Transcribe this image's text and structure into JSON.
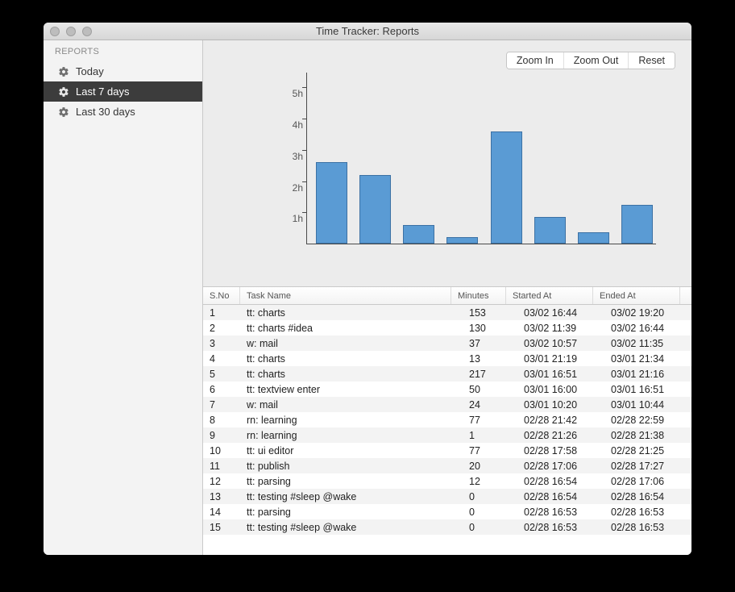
{
  "window": {
    "title": "Time Tracker: Reports"
  },
  "sidebar": {
    "header": "REPORTS",
    "items": [
      {
        "label": "Today",
        "selected": false
      },
      {
        "label": "Last 7 days",
        "selected": true
      },
      {
        "label": "Last 30 days",
        "selected": false
      }
    ]
  },
  "toolbar": {
    "zoom_in": "Zoom In",
    "zoom_out": "Zoom Out",
    "reset": "Reset"
  },
  "chart_data": {
    "type": "bar",
    "title": "",
    "xlabel": "",
    "ylabel": "",
    "ytick_labels": [
      "1h",
      "2h",
      "3h",
      "4h",
      "5h"
    ],
    "ylim": [
      0,
      5.5
    ],
    "categories": [
      "",
      "",
      "",
      "",
      "",
      "",
      "",
      ""
    ],
    "values": [
      2.6,
      2.2,
      0.6,
      0.2,
      3.6,
      0.85,
      0.35,
      1.25
    ],
    "bar_color": "#5a9bd4"
  },
  "table": {
    "columns": [
      "S.No",
      "Task Name",
      "Minutes",
      "Started At",
      "Ended At"
    ],
    "rows": [
      {
        "sno": 1,
        "task": "tt: charts",
        "minutes": 153,
        "start": "03/02 16:44",
        "end": "03/02 19:20"
      },
      {
        "sno": 2,
        "task": "tt: charts #idea",
        "minutes": 130,
        "start": "03/02 11:39",
        "end": "03/02 16:44"
      },
      {
        "sno": 3,
        "task": "w: mail",
        "minutes": 37,
        "start": "03/02 10:57",
        "end": "03/02 11:35"
      },
      {
        "sno": 4,
        "task": "tt: charts",
        "minutes": 13,
        "start": "03/01 21:19",
        "end": "03/01 21:34"
      },
      {
        "sno": 5,
        "task": "tt: charts",
        "minutes": 217,
        "start": "03/01 16:51",
        "end": "03/01 21:16"
      },
      {
        "sno": 6,
        "task": "tt: textview enter",
        "minutes": 50,
        "start": "03/01 16:00",
        "end": "03/01 16:51"
      },
      {
        "sno": 7,
        "task": "w: mail",
        "minutes": 24,
        "start": "03/01 10:20",
        "end": "03/01 10:44"
      },
      {
        "sno": 8,
        "task": "rn: learning",
        "minutes": 77,
        "start": "02/28 21:42",
        "end": "02/28 22:59"
      },
      {
        "sno": 9,
        "task": "rn: learning",
        "minutes": 1,
        "start": "02/28 21:26",
        "end": "02/28 21:38"
      },
      {
        "sno": 10,
        "task": "tt: ui editor",
        "minutes": 77,
        "start": "02/28 17:58",
        "end": "02/28 21:25"
      },
      {
        "sno": 11,
        "task": "tt: publish",
        "minutes": 20,
        "start": "02/28 17:06",
        "end": "02/28 17:27"
      },
      {
        "sno": 12,
        "task": "tt: parsing",
        "minutes": 12,
        "start": "02/28 16:54",
        "end": "02/28 17:06"
      },
      {
        "sno": 13,
        "task": "tt: testing #sleep @wake",
        "minutes": 0,
        "start": "02/28 16:54",
        "end": "02/28 16:54"
      },
      {
        "sno": 14,
        "task": "tt: parsing",
        "minutes": 0,
        "start": "02/28 16:53",
        "end": "02/28 16:53"
      },
      {
        "sno": 15,
        "task": "tt: testing #sleep @wake",
        "minutes": 0,
        "start": "02/28 16:53",
        "end": "02/28 16:53"
      }
    ]
  }
}
